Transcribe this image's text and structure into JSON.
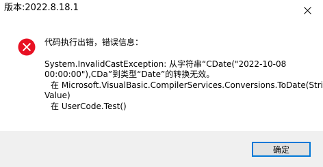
{
  "window": {
    "title": "版本:2022.8.18.1",
    "close_icon": "close-icon"
  },
  "dialog": {
    "icon": "error-icon",
    "icon_color": "#e81123",
    "heading": "代码执行出错，错误信息：",
    "details": [
      "System.InvalidCastException: 从字符串“CDate(\"2022-10-08",
      "00:00:00\"),CDa”到类型“Date”的转换无效。",
      "在 Microsoft.VisualBasic.CompilerServices.Conversions.ToDate(String",
      "Value)",
      "在 UserCode.Test()"
    ]
  },
  "footer": {
    "ok_label": "确定",
    "accent_color": "#0078d7",
    "background": "#f0f0f0"
  }
}
